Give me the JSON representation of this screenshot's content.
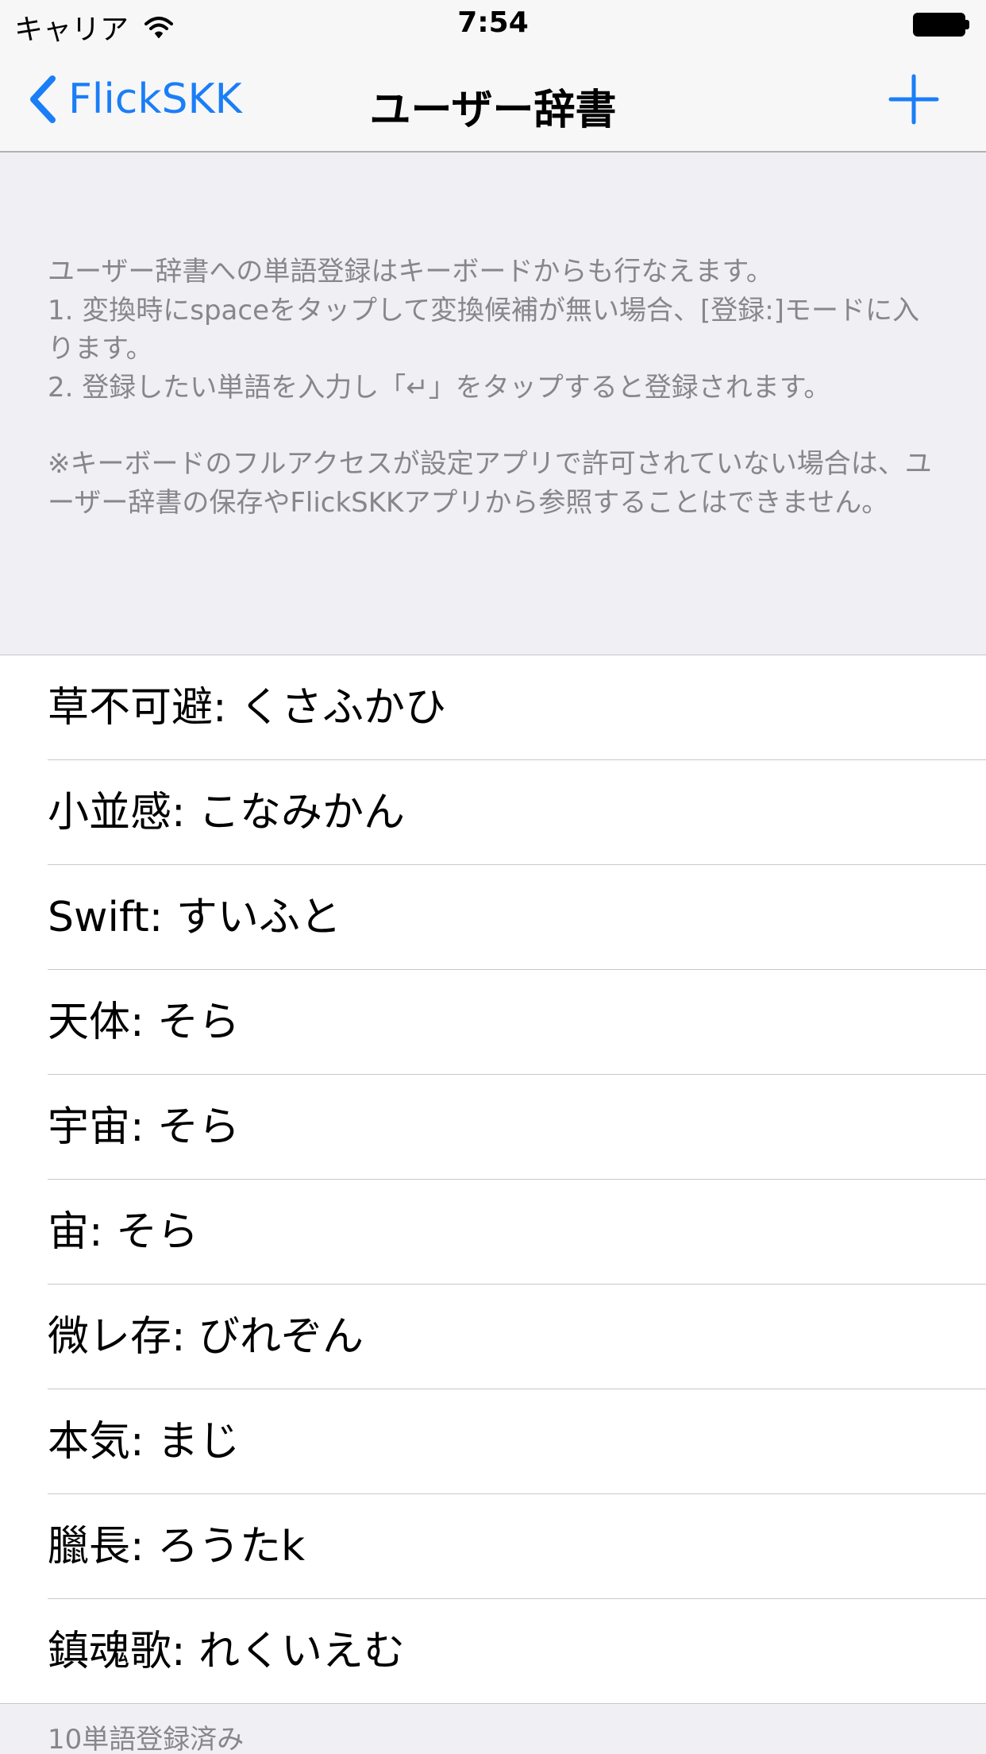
{
  "status_bar": {
    "carrier": "キャリア",
    "time": "7:54",
    "wifi_icon": "wifi-icon",
    "battery_icon": "battery-icon"
  },
  "nav": {
    "back_label": "FlickSKK",
    "back_icon": "chevron-left-icon",
    "title": "ユーザー辞書",
    "add_icon": "plus-icon",
    "accent_color": "#1a7ef7"
  },
  "header": {
    "paragraph_1": "ユーザー辞書への単語登録はキーボードからも行なえます。\n1. 変換時にspaceをタップして変換候補が無い場合、[登録:]モードに入ります。\n2. 登録したい単語を入力し「↵」をタップすると登録されます。",
    "paragraph_2": "※キーボードのフルアクセスが設定アプリで許可されていない場合は、ユーザー辞書の保存やFlickSKKアプリから参照することはできません。"
  },
  "entries": [
    {
      "label": "草不可避: くさふかひ"
    },
    {
      "label": "小並感: こなみかん"
    },
    {
      "label": "Swift: すいふと"
    },
    {
      "label": "天体: そら"
    },
    {
      "label": "宇宙: そら"
    },
    {
      "label": "宙: そら"
    },
    {
      "label": "微レ存: びれぞん"
    },
    {
      "label": "本気: まじ"
    },
    {
      "label": "臘長: ろうたk"
    },
    {
      "label": "鎮魂歌: れくいえむ"
    }
  ],
  "footer": {
    "count_text": "10単語登録済み"
  }
}
